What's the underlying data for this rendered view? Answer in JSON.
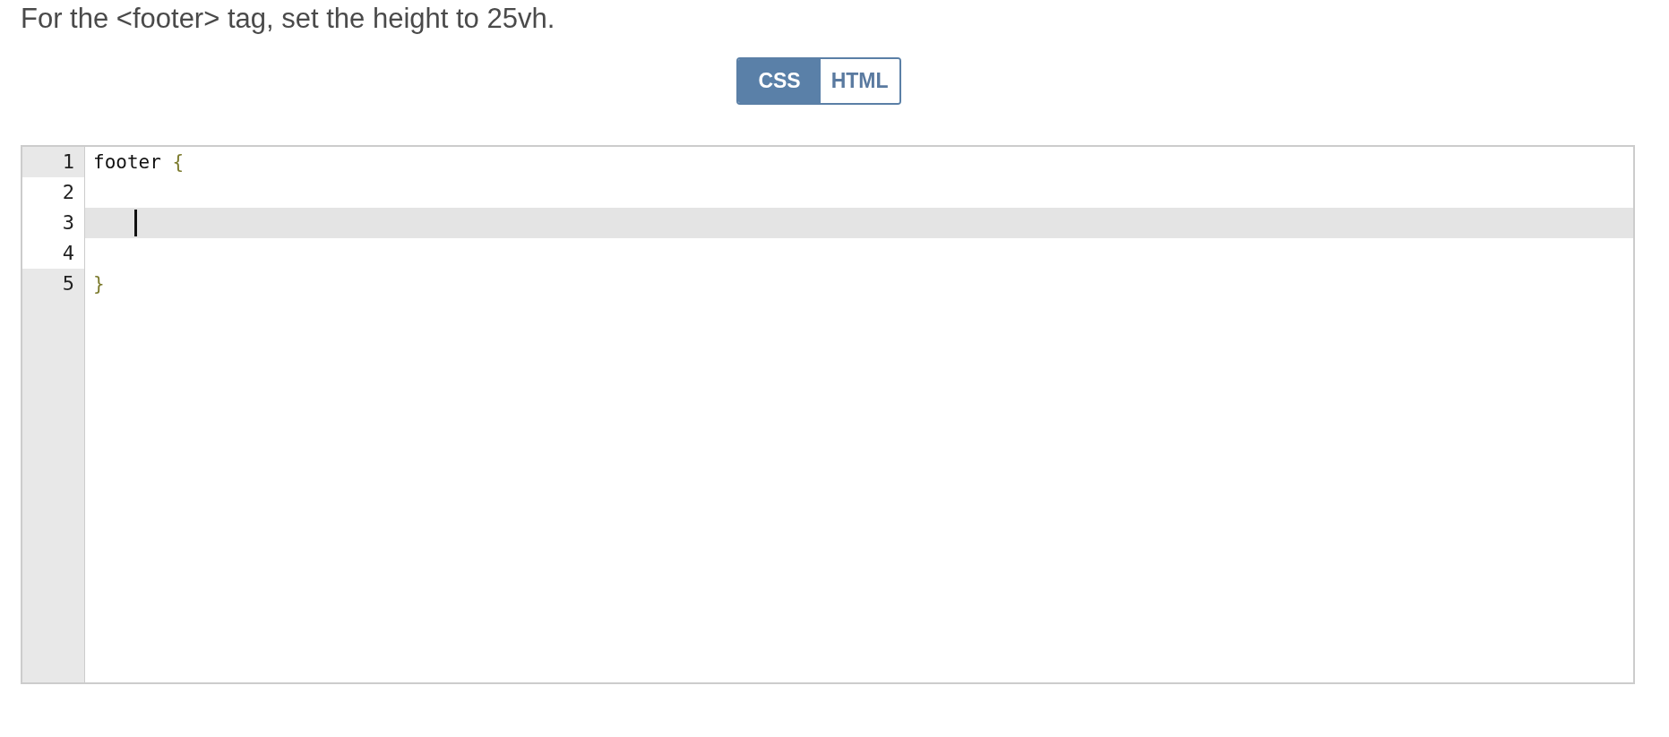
{
  "instruction": "For the <footer> tag, set the height to 25vh.",
  "tabs": [
    {
      "label": "CSS",
      "selected": true
    },
    {
      "label": "HTML",
      "selected": false
    }
  ],
  "editor": {
    "lines": [
      {
        "number": "1",
        "gutter_lit": false,
        "active": false,
        "cursor": false,
        "tokens": [
          {
            "kind": "plain",
            "text": "footer "
          },
          {
            "kind": "bracket",
            "text": "{"
          }
        ]
      },
      {
        "number": "2",
        "gutter_lit": true,
        "active": false,
        "cursor": false
      },
      {
        "number": "3",
        "gutter_lit": true,
        "active": true,
        "cursor": true
      },
      {
        "number": "4",
        "gutter_lit": true,
        "active": false,
        "cursor": false
      },
      {
        "number": "5",
        "gutter_lit": false,
        "active": false,
        "cursor": false,
        "tokens": [
          {
            "kind": "bracket",
            "text": "}"
          }
        ]
      }
    ]
  }
}
